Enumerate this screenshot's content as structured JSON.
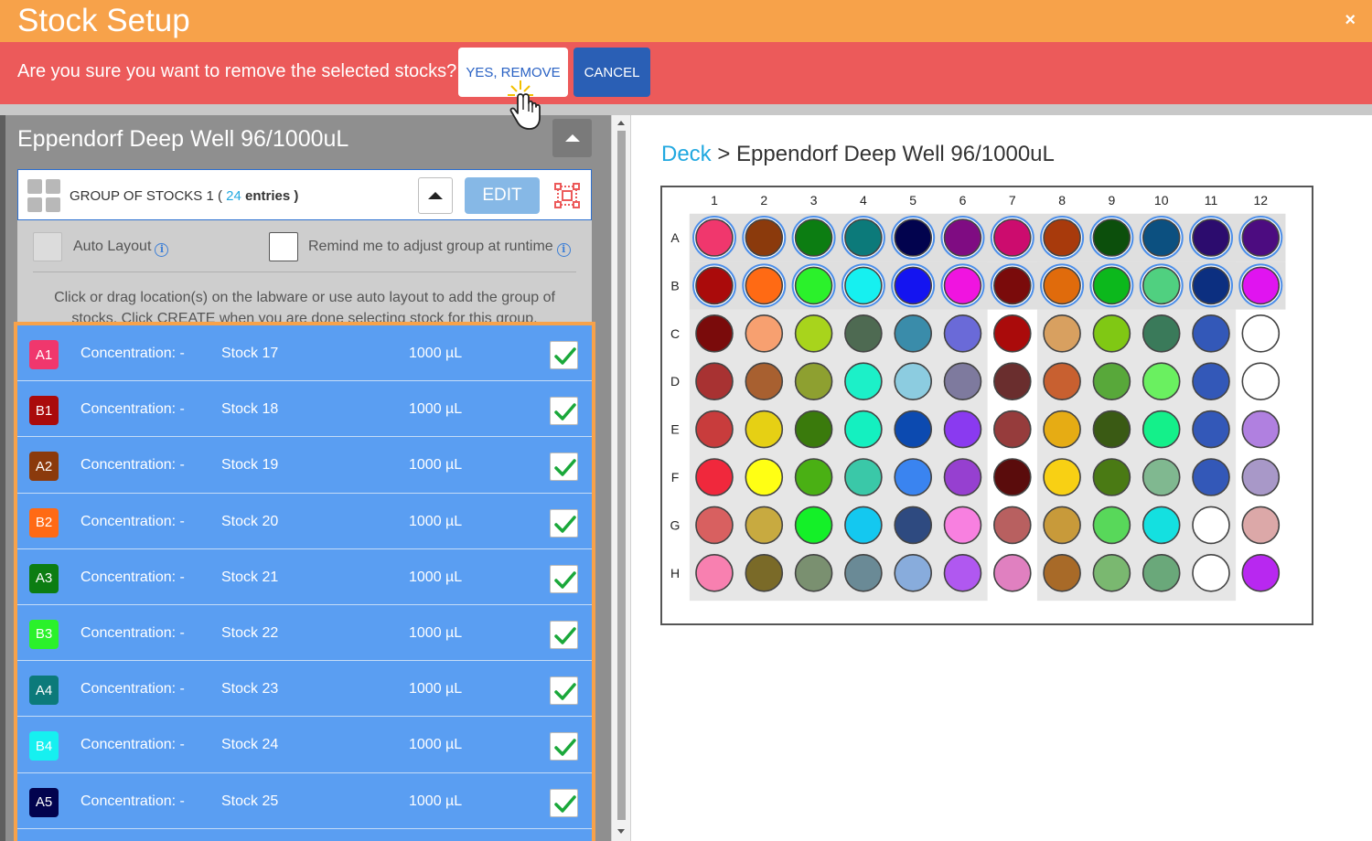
{
  "window": {
    "title": "Stock Setup",
    "close_label": "×"
  },
  "confirm": {
    "message": "Are you sure you want to remove the selected stocks?",
    "yes_label": "YES, REMOVE",
    "cancel_label": "CANCEL"
  },
  "left_panel": {
    "title": "Eppendorf Deep Well 96/1000uL",
    "group": {
      "label": "GROUP OF STOCKS 1 (",
      "count": "24",
      "entries_label": "entries )",
      "edit_label": "EDIT"
    },
    "options": {
      "auto_layout_label": "Auto Layout",
      "remind_label": "Remind me to adjust group at runtime",
      "help_text": "Click or drag location(s) on the labware or use auto layout to add the group of stocks. Click CREATE when you are done selecting stock for this group."
    },
    "stocks": [
      {
        "well": "A1",
        "color": "#f0376d",
        "concentration": "Concentration: -",
        "name": "Stock 17",
        "volume": "1000 µL",
        "checked": true
      },
      {
        "well": "B1",
        "color": "#aa0b0b",
        "concentration": "Concentration: -",
        "name": "Stock 18",
        "volume": "1000 µL",
        "checked": true
      },
      {
        "well": "A2",
        "color": "#8b3a0c",
        "concentration": "Concentration: -",
        "name": "Stock 19",
        "volume": "1000 µL",
        "checked": true
      },
      {
        "well": "B2",
        "color": "#ff6a14",
        "concentration": "Concentration: -",
        "name": "Stock 20",
        "volume": "1000 µL",
        "checked": true
      },
      {
        "well": "A3",
        "color": "#0c7d12",
        "concentration": "Concentration: -",
        "name": "Stock 21",
        "volume": "1000 µL",
        "checked": true
      },
      {
        "well": "B3",
        "color": "#2bf12b",
        "concentration": "Concentration: -",
        "name": "Stock 22",
        "volume": "1000 µL",
        "checked": true
      },
      {
        "well": "A4",
        "color": "#0c7a7a",
        "concentration": "Concentration: -",
        "name": "Stock 23",
        "volume": "1000 µL",
        "checked": true
      },
      {
        "well": "B4",
        "color": "#16f0f0",
        "concentration": "Concentration: -",
        "name": "Stock 24",
        "volume": "1000 µL",
        "checked": true
      },
      {
        "well": "A5",
        "color": "#02034e",
        "concentration": "Concentration: -",
        "name": "Stock 25",
        "volume": "1000 µL",
        "checked": true
      }
    ]
  },
  "right_panel": {
    "breadcrumb": {
      "root": "Deck",
      "separator": " > ",
      "current": "Eppendorf Deep Well 96/1000uL"
    },
    "plate": {
      "columns": [
        "1",
        "2",
        "3",
        "4",
        "5",
        "6",
        "7",
        "8",
        "9",
        "10",
        "11",
        "12"
      ],
      "rows": [
        "A",
        "B",
        "C",
        "D",
        "E",
        "F",
        "G",
        "H"
      ],
      "selected_rows": [
        "A",
        "B"
      ],
      "well_colors": [
        [
          "#f0376d",
          "#8b3a0c",
          "#0c7d12",
          "#0c7a7a",
          "#02034e",
          "#7f0c82",
          "#cc0c6e",
          "#a83a0c",
          "#0c4f0c",
          "#0c5080",
          "#2c0c6e",
          "#4c0c80"
        ],
        [
          "#aa0b0b",
          "#ff6a14",
          "#2bf12b",
          "#16f0f0",
          "#1414f0",
          "#f014e0",
          "#7a0b0b",
          "#e06b0c",
          "#0cb81c",
          "#50d080",
          "#0c2f80",
          "#e014f0"
        ],
        [
          "#7a0b0b",
          "#f7a070",
          "#a8d41c",
          "#4e6a52",
          "#3a8caa",
          "#6a6ad8",
          "#aa0b0b",
          "#d8a060",
          "#80c814",
          "#3a7a5a",
          "#3358b8",
          "#ffffff"
        ],
        [
          "#a83232",
          "#a86030",
          "#8ea030",
          "#1cf0c8",
          "#8ccce0",
          "#7e7a9e",
          "#6a2e2e",
          "#c86030",
          "#58a83a",
          "#6af060",
          "#3358b8",
          "#ffffff"
        ],
        [
          "#c83c3c",
          "#e6d014",
          "#3a7a0c",
          "#14f0c0",
          "#0c4ab0",
          "#8a3af0",
          "#963c3c",
          "#e6ac14",
          "#3a5a14",
          "#14f08a",
          "#3358b8",
          "#b080e0"
        ],
        [
          "#f0283c",
          "#ffff14",
          "#4ab014",
          "#3ac8a8",
          "#3a84f0",
          "#9640d0",
          "#5a0c0c",
          "#f8d014",
          "#4a7a14",
          "#80b890",
          "#3358b8",
          "#a898c8"
        ],
        [
          "#d86060",
          "#c8aa40",
          "#14f028",
          "#14c8f0",
          "#2e4a80",
          "#f880e0",
          "#b86060",
          "#c89a3a",
          "#58d85a",
          "#14e0e0",
          "#ffffff",
          "#dca8a8"
        ],
        [
          "#f880b0",
          "#7a6a28",
          "#7a9070",
          "#6a8a96",
          "#88acdc",
          "#b058f0",
          "#e080c0",
          "#a86a28",
          "#7ab870",
          "#6aa87a",
          "#ffffff",
          "#b828f0"
        ]
      ]
    }
  }
}
